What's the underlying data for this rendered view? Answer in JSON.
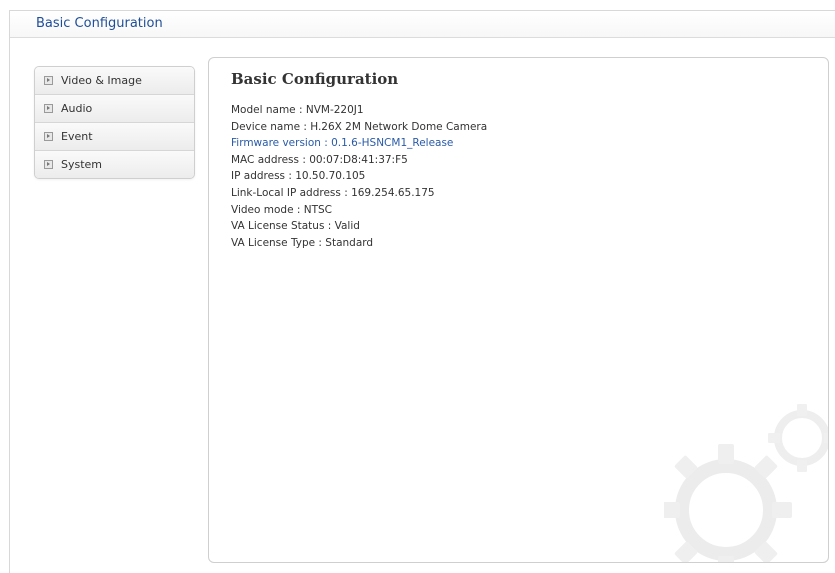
{
  "header": {
    "title": "Basic Configuration"
  },
  "sidebar": {
    "items": [
      {
        "label": "Video & Image",
        "icon": "expand-arrow-icon"
      },
      {
        "label": "Audio",
        "icon": "expand-arrow-icon"
      },
      {
        "label": "Event",
        "icon": "expand-arrow-icon"
      },
      {
        "label": "System",
        "icon": "expand-arrow-icon"
      }
    ]
  },
  "main": {
    "title": "Basic Configuration",
    "info": [
      "Model name : NVM-220J1",
      "Device name : H.26X 2M Network Dome Camera",
      "Firmware version : 0.1.6-HSNCM1_Release",
      "MAC address : 00:07:D8:41:37:F5",
      "IP address : 10.50.70.105",
      "Link-Local IP address : 169.254.65.175",
      "Video mode : NTSC",
      "VA License Status : Valid",
      "VA License Type : Standard"
    ],
    "decoration_icon": "gear-watermark-icon"
  },
  "colors": {
    "title_blue": "#1f4e99",
    "link_blue": "#2a5aa8",
    "text": "#333333",
    "border": "#cfcfcf"
  }
}
